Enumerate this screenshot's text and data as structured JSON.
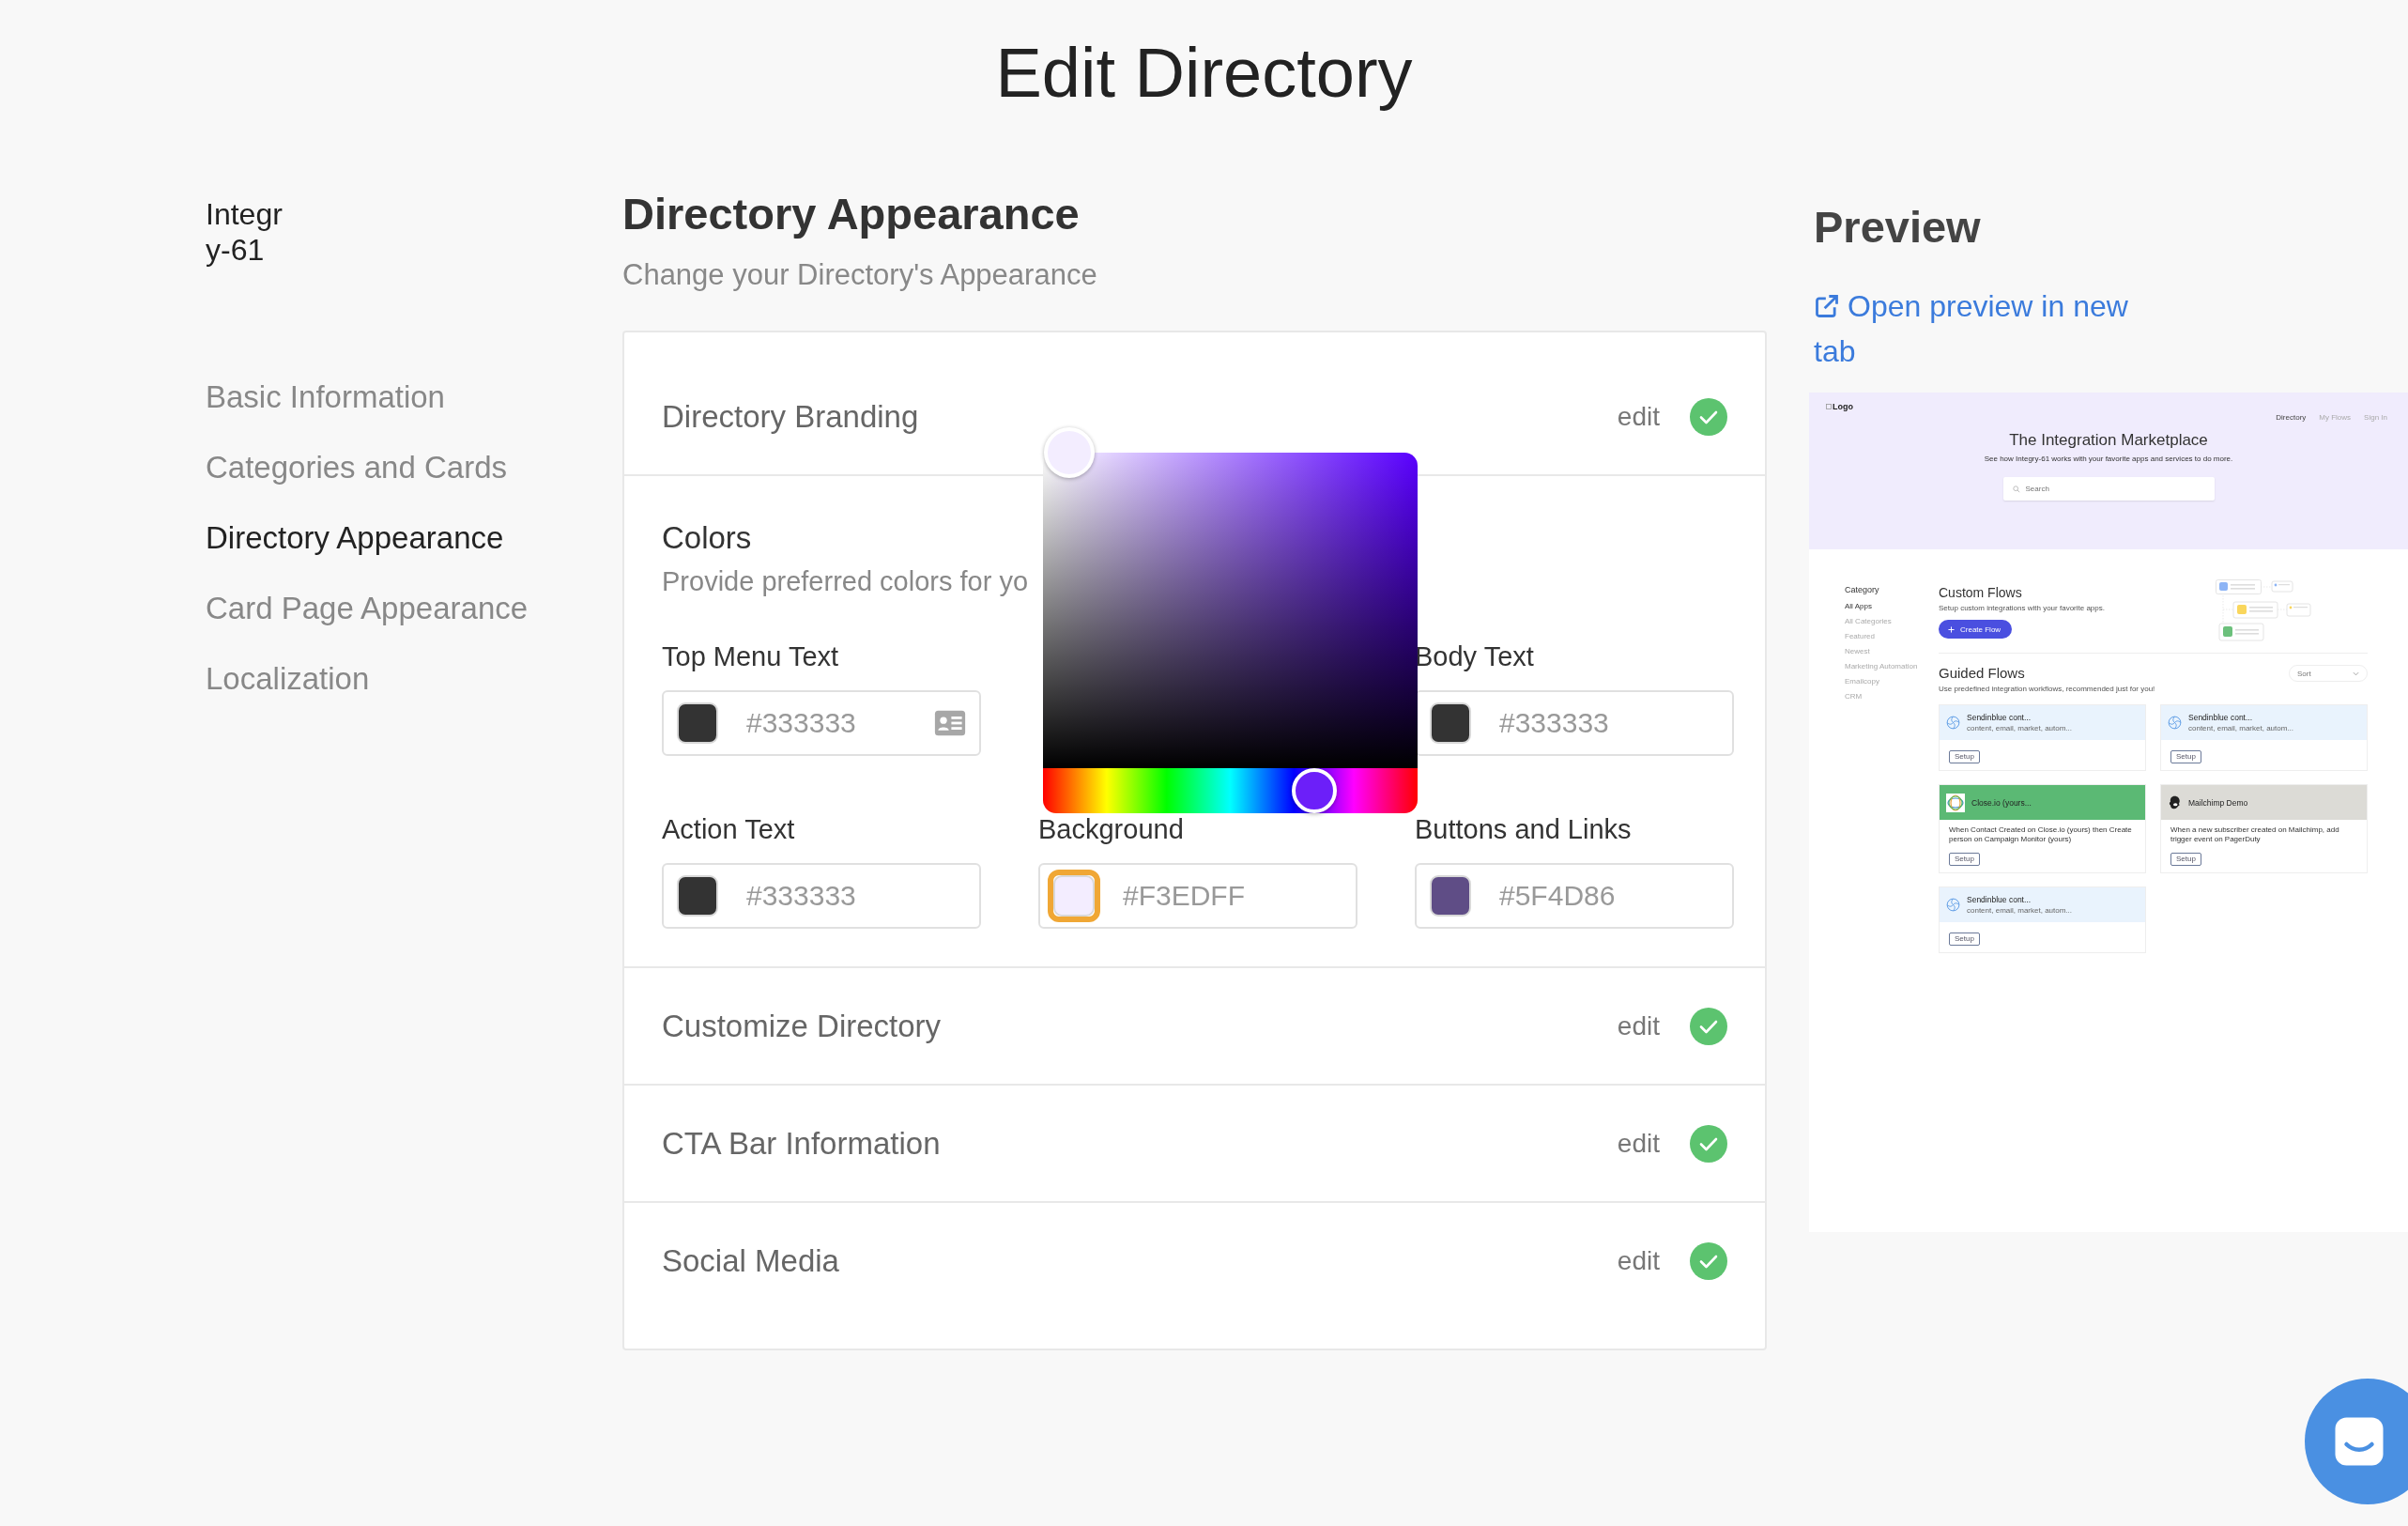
{
  "page_title": "Edit Directory",
  "sidebar": {
    "account": "Integry-61",
    "items": [
      {
        "label": "Basic Information",
        "selected": false
      },
      {
        "label": "Categories and Cards",
        "selected": false
      },
      {
        "label": "Directory Appearance",
        "selected": true
      },
      {
        "label": "Card Page Appearance",
        "selected": false
      },
      {
        "label": "Localization",
        "selected": false
      }
    ]
  },
  "main": {
    "heading": "Directory Appearance",
    "subheading": "Change your Directory's Appearance",
    "sections": [
      {
        "kind": "collapsed",
        "title": "Directory Branding",
        "action": "edit",
        "complete": true
      },
      {
        "kind": "colors",
        "title": "Colors",
        "description": "Provide preferred colors for yo",
        "picker": {
          "level": 0.725
        },
        "fields": [
          {
            "kind": "color",
            "label": "Top Menu Text",
            "value": "#333333",
            "color": "#333333",
            "focused": false,
            "autofill_icon": true
          },
          {
            "kind": "covered"
          },
          {
            "kind": "color",
            "label": "Body Text",
            "value": "#333333",
            "color": "#333333",
            "focused": false,
            "autofill_icon": false
          },
          {
            "kind": "color",
            "label": "Action Text",
            "value": "#333333",
            "color": "#333333",
            "focused": false,
            "autofill_icon": false
          },
          {
            "kind": "color",
            "label": "Background",
            "value": "#F3EDFF",
            "color": "#f3edff",
            "focused": true,
            "autofill_icon": false
          },
          {
            "kind": "color",
            "label": "Buttons and Links",
            "value": "#5F4D86",
            "color": "#5f4d86",
            "focused": false,
            "autofill_icon": false
          }
        ]
      },
      {
        "kind": "collapsed",
        "title": "Customize Directory",
        "action": "edit",
        "complete": true
      },
      {
        "kind": "collapsed",
        "title": "CTA Bar Information",
        "action": "edit",
        "complete": true
      },
      {
        "kind": "collapsed",
        "title": "Social Media",
        "action": "edit",
        "complete": true
      }
    ]
  },
  "preview": {
    "heading": "Preview",
    "link": "Open preview in new tab",
    "site": {
      "logo": "Logo",
      "nav": [
        {
          "label": "Directory",
          "selected": true
        },
        {
          "label": "My Flows",
          "selected": false
        },
        {
          "label": "Sign In",
          "selected": false
        }
      ],
      "title": "The Integration Marketplace",
      "subtitle": "See how Integry-61 works with your favorite apps and services to do more.",
      "search": {
        "placeholder": "Search"
      },
      "category_heading": "Category",
      "categories": [
        {
          "label": "All Apps",
          "selected": true
        },
        {
          "label": "All Categories",
          "selected": false
        },
        {
          "label": "Featured",
          "selected": false
        },
        {
          "label": "Newest",
          "selected": false
        },
        {
          "label": "Marketing Automation",
          "selected": false
        },
        {
          "label": "Emailcopy",
          "selected": false
        },
        {
          "label": "CRM",
          "selected": false
        }
      ],
      "custom_flows": {
        "title": "Custom Flows",
        "subtitle": "Setup custom integrations with your favorite apps.",
        "button": "Create Flow"
      },
      "guided_flows": {
        "title": "Guided Flows",
        "subtitle": "Use predefined integration workflows, recommended just for you!",
        "sort": "Sort",
        "cards": [
          {
            "kind": "tags",
            "title": "Sendinblue cont...",
            "text": "content, email, market, autom...",
            "button": "Setup",
            "color": "#e9f3fd"
          },
          {
            "kind": "tags",
            "title": "Sendinblue cont...",
            "text": "content, email, market, autom...",
            "button": "Setup",
            "color": "#e9f3fd"
          },
          {
            "kind": "description",
            "title": "Close.io (yours...",
            "text": "When Contact Created on Close.io (yours) then Create person on Campaign Monitor (yours)",
            "button": "Setup",
            "color": "#5bb974"
          },
          {
            "kind": "description",
            "title": "Mailchimp Demo",
            "text": "When a new subscriber created on Mailchimp, add trigger event on PagerDuty",
            "button": "Setup",
            "color": "#dcdbd6"
          },
          {
            "kind": "tags",
            "title": "Sendinblue cont...",
            "text": "content, email, market, autom...",
            "button": "Setup",
            "color": "#e9f3fd"
          }
        ]
      }
    }
  }
}
